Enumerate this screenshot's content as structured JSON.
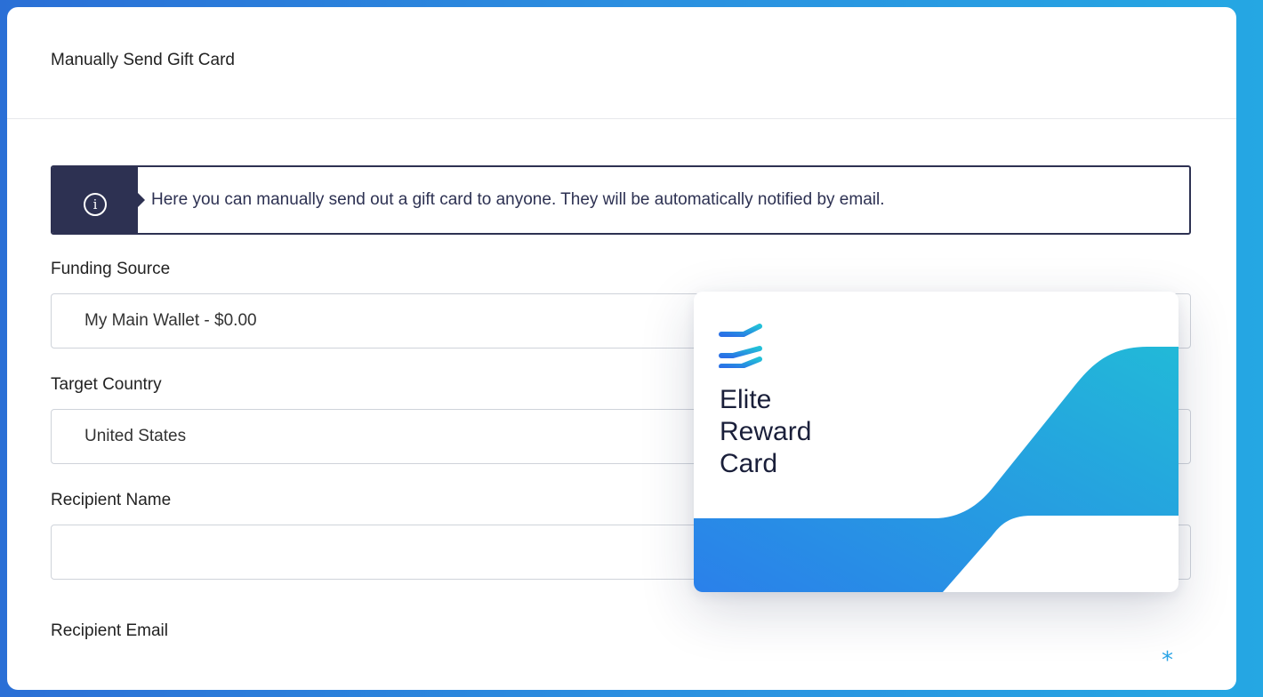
{
  "header": {
    "title": "Manually Send Gift Card"
  },
  "notice": {
    "icon": "info-icon",
    "text": "Here you can manually send out a gift card to anyone. They will be automatically notified by email."
  },
  "form": {
    "funding_source": {
      "label": "Funding Source",
      "value": "My Main Wallet - $0.00"
    },
    "target_country": {
      "label": "Target Country",
      "value": "United States"
    },
    "recipient_name": {
      "label": "Recipient Name",
      "value": ""
    },
    "recipient_email": {
      "label": "Recipient Email"
    }
  },
  "card": {
    "name": "Elite Reward Card",
    "name_lines": [
      "Elite",
      "Reward",
      "Card"
    ],
    "logo_icon": "stripes-logo-icon"
  },
  "decor": {
    "asterisk": "*"
  },
  "colors": {
    "navy": "#2d3152",
    "accent_blue": "#2a80ea",
    "accent_cyan": "#22b9d8"
  }
}
